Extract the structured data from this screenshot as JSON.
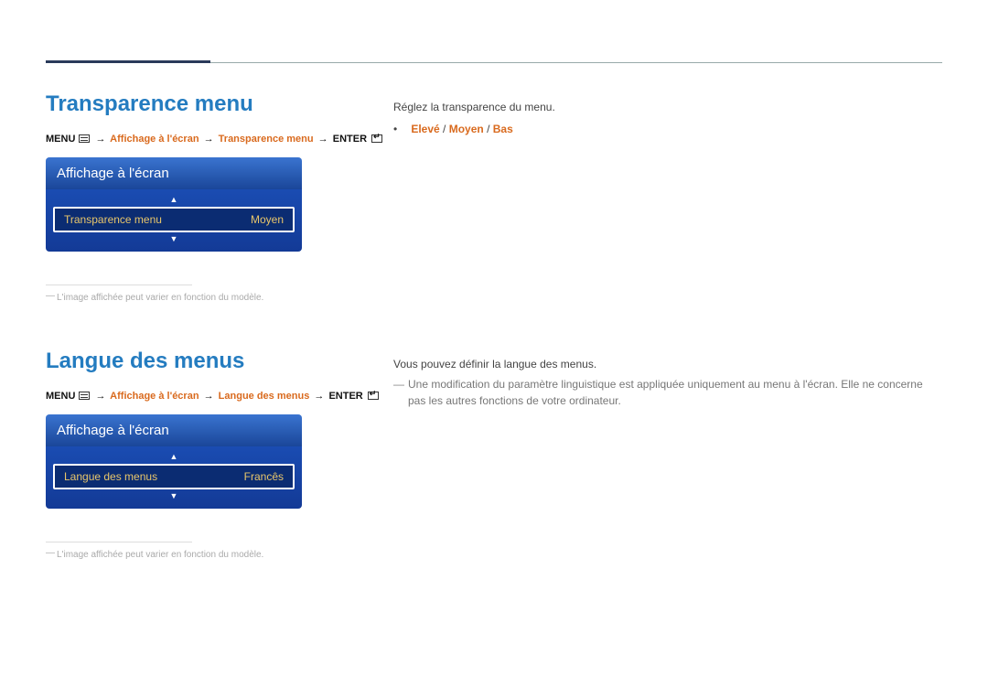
{
  "section1": {
    "title": "Transparence menu",
    "path_menu_label": "MENU",
    "path_step1": "Affichage à l'écran",
    "path_step2": "Transparence menu",
    "path_enter_label": "ENTER",
    "osd_header": "Affichage à l'écran",
    "osd_item_label": "Transparence menu",
    "osd_item_value": "Moyen",
    "footnote": "L'image affichée peut varier en fonction du modèle.",
    "desc": "Réglez la transparence du menu.",
    "options_a": "Elevé",
    "options_b": "Moyen",
    "options_c": "Bas"
  },
  "section2": {
    "title": "Langue des menus",
    "path_menu_label": "MENU",
    "path_step1": "Affichage à l'écran",
    "path_step2": "Langue des menus",
    "path_enter_label": "ENTER",
    "osd_header": "Affichage à l'écran",
    "osd_item_label": "Langue des menus",
    "osd_item_value": "Francês",
    "footnote": "L'image affichée peut varier en fonction du modèle.",
    "desc": "Vous pouvez définir la langue des menus.",
    "note": "Une modification du paramètre linguistique est appliquée uniquement au menu à l'écran. Elle ne concerne pas les autres fonctions de votre ordinateur."
  }
}
